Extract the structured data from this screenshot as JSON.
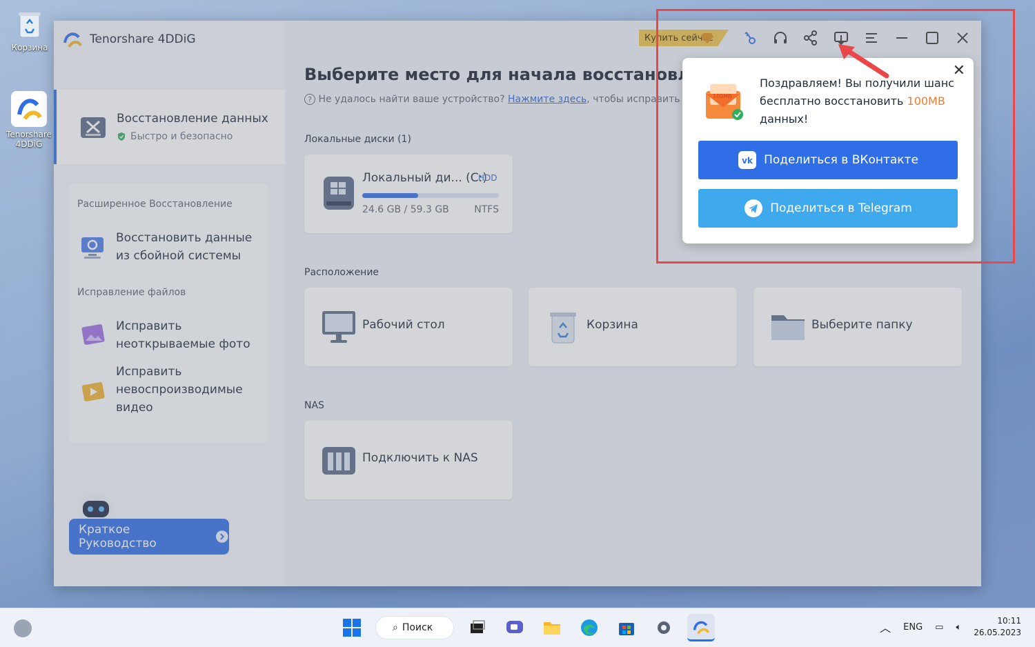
{
  "desktop": {
    "icons": [
      {
        "label": "Корзина"
      },
      {
        "label": "Tenorshare 4DDiG"
      }
    ]
  },
  "app": {
    "title": "Tenorshare 4DDiG",
    "buy_label": "Купить сейчас",
    "sidebar": {
      "active": {
        "title": "Восстановление данных",
        "subtitle": "Быстро и безопасно"
      },
      "advanced_header": "Расширенное Восстановление",
      "advanced_item": "Восстановить данные из сбойной системы",
      "fix_header": "Исправление файлов",
      "fix_photo": "Исправить неоткрываемые фото",
      "fix_video": "Исправить невоспроизводимые видео",
      "guide": "Краткое Руководство"
    },
    "main": {
      "title": "Выберите место для начала восстановления",
      "hint_prefix": "Не удалось найти ваше устройство?",
      "hint_link": "Нажмите здесь",
      "hint_suffix": ", чтобы исправить пр",
      "local_label": "Локальные диски (1)",
      "disk": {
        "name": "Локальный ди... (C:)",
        "badge": "HDD",
        "used": "24.6 GB / 59.3 GB",
        "fs": "NTFS",
        "usage_fraction": 0.41
      },
      "location_label": "Расположение",
      "locations": [
        "Рабочий стол",
        "Корзина",
        "Выберите папку"
      ],
      "nas_label": "NAS",
      "nas_card": "Подключить к NAS"
    }
  },
  "popup": {
    "msg_part1": "Поздравляем! Вы получили шанс бесплатно восстановить ",
    "msg_highlight": "100MB",
    "msg_part2": " данных!",
    "badge": "100MB",
    "vk_label": "Поделиться в ВКонтакте",
    "tg_label": "Поделиться в Telegram"
  },
  "taskbar": {
    "search": "Поиск",
    "lang": "ENG",
    "time": "10:11",
    "date": "26.05.2023"
  },
  "colors": {
    "accent": "#2f6ee6",
    "telegram": "#3fa9ee",
    "highlight": "#f47a2a",
    "annotation": "#e9474a"
  }
}
